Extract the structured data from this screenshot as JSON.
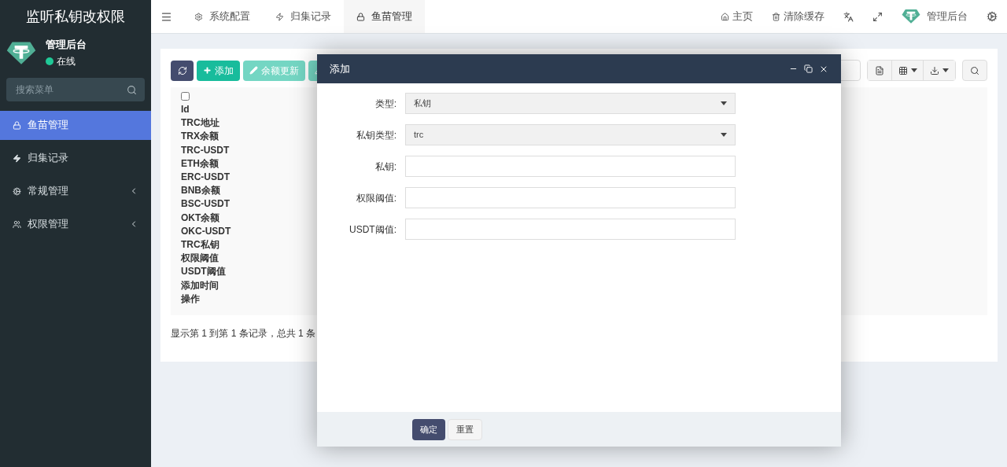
{
  "sidebar": {
    "title": "监听私钥改权限",
    "user": {
      "name": "管理后台",
      "status": "在线",
      "online": true
    },
    "search": {
      "placeholder": "搜索菜单"
    },
    "items": [
      {
        "label": "鱼苗管理",
        "selected": true,
        "has_submenu": false
      },
      {
        "label": "归集记录",
        "selected": false,
        "has_submenu": false
      },
      {
        "label": "常规管理",
        "selected": false,
        "has_submenu": true
      },
      {
        "label": "权限管理",
        "selected": false,
        "has_submenu": true
      }
    ]
  },
  "tabs": [
    {
      "label": "系统配置",
      "selected": false
    },
    {
      "label": "归集记录",
      "selected": false
    },
    {
      "label": "鱼苗管理",
      "selected": true
    }
  ],
  "top_right": {
    "home": "主页",
    "clear_cache": "清除缓存",
    "admin": "管理后台"
  },
  "toolbar": {
    "add": "添加",
    "update_balance": "余额更新"
  },
  "table": {
    "columns": [
      "Id",
      "TRC地址",
      "TRX余额",
      "TRC-USDT",
      "ETH余额",
      "ERC-USDT",
      "BNB余额",
      "BSC-USDT",
      "OKT余额",
      "OKC-USDT",
      "TRC私钥",
      "权限阈值",
      "USDT阈值",
      "添加时间",
      "操作"
    ],
    "select_all": {
      "checked": false
    }
  },
  "pagination_info": "显示第 1 到第 1 条记录，总共 1 条",
  "dialog": {
    "title": "添加",
    "fields": [
      {
        "kind": "select",
        "label": "类型:",
        "value": "私钥"
      },
      {
        "kind": "select",
        "label": "私钥类型:",
        "value": "trc"
      },
      {
        "kind": "text",
        "label": "私钥:"
      },
      {
        "kind": "text",
        "label": "权限阈值:"
      },
      {
        "kind": "text",
        "label": "USDT阈值:"
      }
    ],
    "buttons": [
      {
        "kind": "primary",
        "label": "确定"
      },
      {
        "kind": "default",
        "label": "重置"
      }
    ]
  }
}
